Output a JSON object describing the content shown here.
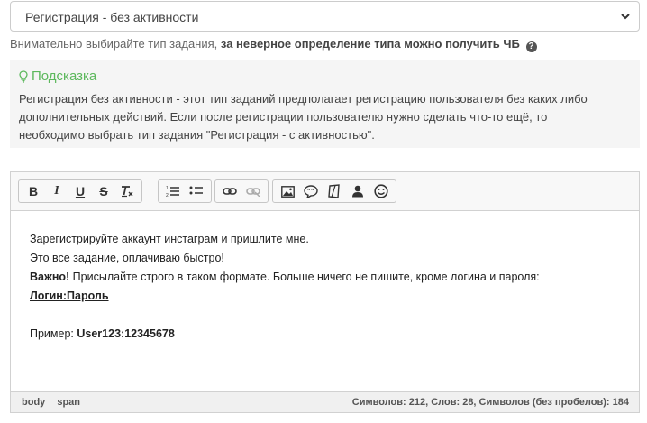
{
  "task_type": {
    "selected": "Регистрация - без активности"
  },
  "help": {
    "prefix": "Внимательно выбирайте тип задания,",
    "warning": "за неверное определение типа можно получить",
    "badge": "ЧБ",
    "q_icon": "?"
  },
  "hint": {
    "title": "Подсказка",
    "line1": "Регистрация без активности - этот тип заданий предполагает регистрацию пользователя без каких либо",
    "line2": "дополнительных действий. Если после регистрации пользователю нужно сделать что-то ещё, то",
    "line3": "необходимо выбрать тип задания \"Регистрация - с активностью\".",
    "color": "#5cb85c"
  },
  "toolbar": {
    "bold": "B",
    "italic": "I",
    "underline": "U",
    "strike": "S"
  },
  "content": {
    "line1": "Зарегистрируйте аккаунт инстаграм и пришлите мне.",
    "line2": "Это все задание, оплачиваю быстро!",
    "line3_bold": "Важно!",
    "line3_rest": " Присылайте строго в таком формате. Больше ничего не пишите, кроме логина и пароля:",
    "line4": "Логин:Пароль",
    "example_label": "Пример: ",
    "example_value": "User123:12345678"
  },
  "statusbar": {
    "path": [
      "body",
      "span"
    ],
    "counts": "Символов: 212, Слов: 28, Символов (без пробелов): 184"
  }
}
